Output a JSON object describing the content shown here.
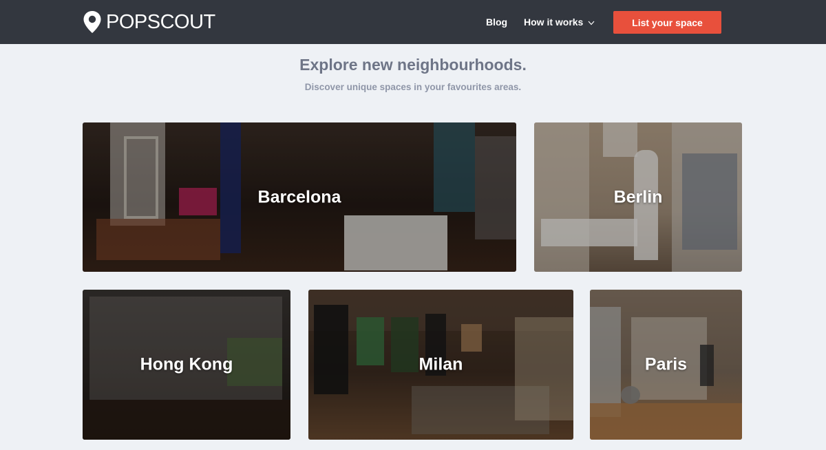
{
  "brand": {
    "name": "POPSCOUT",
    "logo_icon": "map-pin-icon"
  },
  "nav": {
    "blog": "Blog",
    "how_it_works": "How it works",
    "how_it_works_icon": "chevron-down-icon",
    "cta": "List your space"
  },
  "hero": {
    "title": "Explore new neighbourhoods.",
    "subtitle": "Discover unique spaces in your favourites areas."
  },
  "cities": [
    {
      "name": "Barcelona"
    },
    {
      "name": "Berlin"
    },
    {
      "name": "Hong Kong"
    },
    {
      "name": "Milan"
    },
    {
      "name": "Paris"
    }
  ],
  "colors": {
    "nav_bg": "#33373f",
    "cta_bg": "#e8503c",
    "page_bg": "#eef1f5",
    "heading": "#6e7587"
  }
}
